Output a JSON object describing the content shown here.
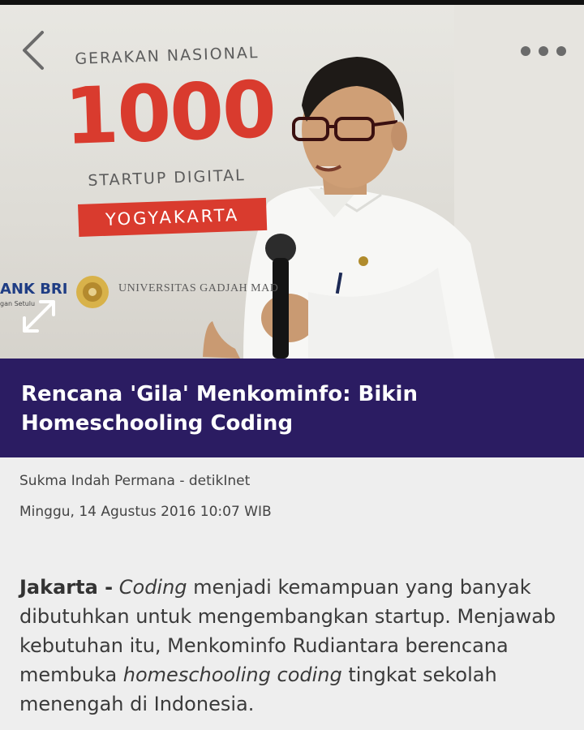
{
  "banner": {
    "line1": "GERAKAN NASIONAL",
    "number": "1000",
    "line2": "STARTUP DIGITAL",
    "city": "YOGYAKARTA"
  },
  "sponsors": {
    "bank": "ANK BRI",
    "bank_sub": "gan Setulu",
    "university": "UNIVERSITAS GADJAH MAD"
  },
  "article": {
    "title": "Rencana 'Gila' Menkominfo: Bikin Homeschooling Coding",
    "byline": "Sukma Indah Permana - detikInet",
    "date": "Minggu, 14 Agustus 2016 10:07 WIB",
    "lead": {
      "location": "Jakarta -",
      "p1_em": "Coding",
      "p1_rest": " menjadi kemampuan yang banyak dibutuhkan untuk mengembangkan startup. Menjawab kebutuhan itu, Menkominfo Rudiantara berencana membuka ",
      "p2_em": "homeschooling coding",
      "p2_rest": " tingkat sekolah menengah di Indonesia."
    }
  },
  "icons": {
    "back": "chevron-left-icon",
    "more": "more-horizontal-icon",
    "expand": "expand-icon"
  },
  "colors": {
    "title_band": "#2b1c62",
    "brand_red": "#d93b2e",
    "page_bg": "#eeeeee"
  }
}
